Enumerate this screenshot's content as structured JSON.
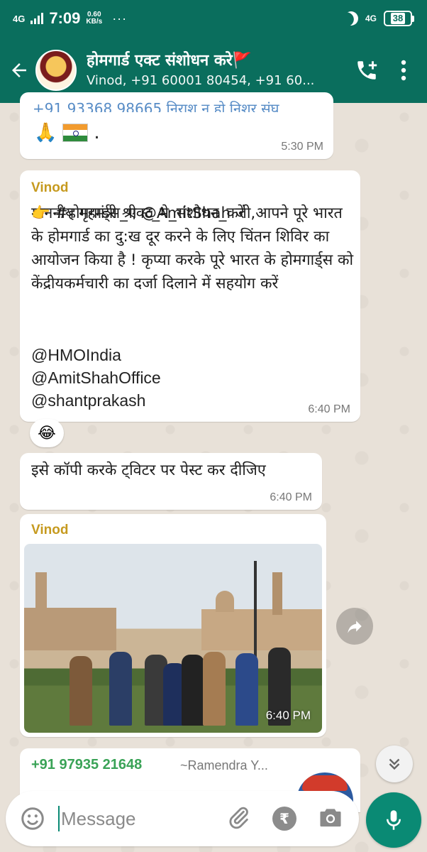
{
  "status_bar": {
    "network": "4G",
    "time": "7:09",
    "speed_value": "0.60",
    "speed_unit": "KB/s",
    "more": "···",
    "network_right": "4G",
    "battery": "38"
  },
  "header": {
    "group_name": "होमगार्ड एक्ट संशोधन करे🚩",
    "participants": "Vinod, +91 60001 80454, +91 60..."
  },
  "messages": {
    "m1": {
      "clipped_text": "+91 93368 98665      निराश न हो   निशूर संघ",
      "emoji": "🙏",
      "trailing": ".",
      "time": "5:30 PM"
    },
    "m2": {
      "sender": "Vinod",
      "body": "माननीय गृहमंत्री श्री @AmitShah जी,आपने पूरे भारत के होमगार्ड का दु:ख दूर करने के लिए चिंतन शिविर का आयोजन किया है ! कृप्या करके पूरे भारत के होमगार्ड्स को केंद्रीयकर्मचारी का दर्जा दिलाने में सहयोग करें",
      "hashtag": "👉 #होमगार्ड्स_एक्ट_मे_संशोधन_करें",
      "mention1": "@HMOIndia",
      "mention2": "@AmitShahOffice",
      "mention3": "@shantprakash",
      "time": "6:40 PM",
      "reaction": "😂"
    },
    "m3": {
      "body": "इसे कॉपी करके ट्विटर पर पेस्ट कर दीजिए",
      "time": "6:40 PM"
    },
    "m4": {
      "sender": "Vinod",
      "time": "6:40 PM"
    },
    "m5": {
      "phone": "+91 97935 21648",
      "name": "~Ramendra Y..."
    }
  },
  "input": {
    "placeholder": "Message"
  },
  "colors": {
    "header_green": "#0a6e5d",
    "accent_green": "#0a8a74",
    "sender_gold": "#c69a1f",
    "phone_green": "#3aa357"
  }
}
